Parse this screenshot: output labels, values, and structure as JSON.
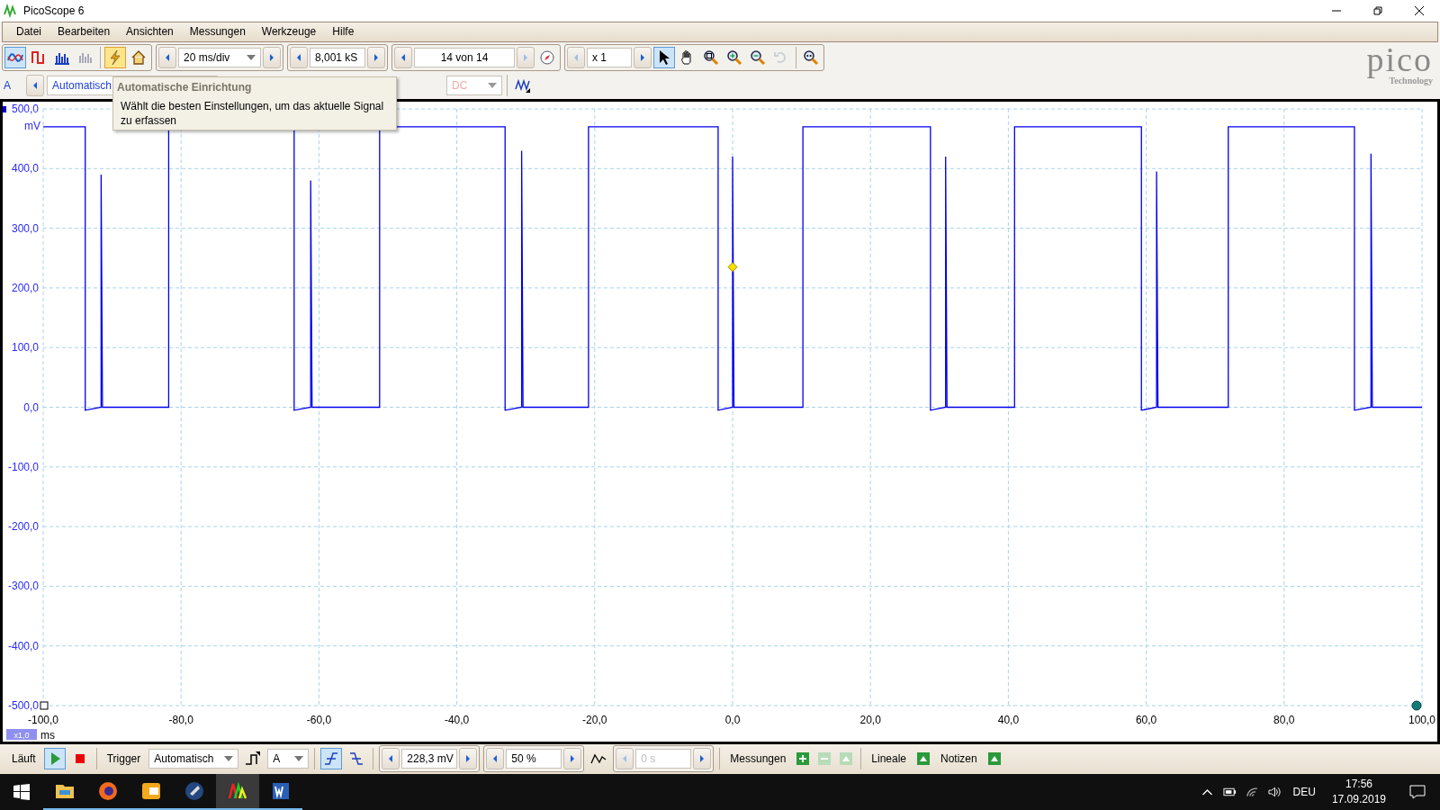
{
  "window": {
    "title": "PicoScope 6"
  },
  "menu": [
    "Datei",
    "Bearbeiten",
    "Ansichten",
    "Messungen",
    "Werkzeuge",
    "Hilfe"
  ],
  "view_modes": [
    {
      "kind": "scope",
      "selected": true
    },
    {
      "kind": "persistence",
      "selected": false
    },
    {
      "kind": "spectrum",
      "selected": false
    },
    {
      "kind": "spectrum-off",
      "selected": false
    }
  ],
  "auto_setup": {
    "selected": true
  },
  "timebase": "20 ms/div",
  "samples": "8,001 kS",
  "buffer": "14 von 14",
  "zoom_factor": "x 1",
  "tools": [
    {
      "kind": "pointer",
      "selected": true,
      "disabled": false
    },
    {
      "kind": "hand",
      "selected": false,
      "disabled": false
    },
    {
      "kind": "zoom-box",
      "selected": false,
      "disabled": false
    },
    {
      "kind": "zoom-in",
      "selected": false,
      "disabled": false
    },
    {
      "kind": "zoom-out",
      "selected": false,
      "disabled": false
    },
    {
      "kind": "undo",
      "selected": false,
      "disabled": true
    },
    {
      "kind": "zoom-100",
      "selected": false,
      "disabled": false
    }
  ],
  "logo": {
    "text": "pico",
    "subtext": "Technology"
  },
  "channel_bar": {
    "channel": "A",
    "range": "Automatisch",
    "coupling": "DC"
  },
  "tooltip": {
    "title": "Automatische Einrichtung",
    "body": "Wählt die besten Einstellungen, um das aktuelle Signal zu erfassen"
  },
  "plot": {
    "y_unit": "mV",
    "y_ticks": [
      "500,0",
      "400,0",
      "300,0",
      "200,0",
      "100,0",
      "0,0",
      "-100,0",
      "-200,0",
      "-300,0",
      "-400,0",
      "-500,0"
    ],
    "x_ticks": [
      "-100,0",
      "-80,0",
      "-60,0",
      "-40,0",
      "-20,0",
      "0,0",
      "20,0",
      "40,0",
      "60,0",
      "80,0",
      "100,0"
    ],
    "x_unit": "ms",
    "zoom_badge": "x1,0"
  },
  "bottom_bar": {
    "run_state": "Läuft",
    "running": true,
    "trigger_label": "Trigger",
    "trigger_mode": "Automatisch",
    "trigger_source": "A",
    "rising_edge": true,
    "threshold": "228,3 mV",
    "pre_trigger": "50 %",
    "delay": "0 s",
    "measurements_label": "Messungen",
    "rulers_label": "Lineale",
    "notes_label": "Notizen"
  },
  "taskbar": {
    "apps": [
      {
        "kind": "folder",
        "active": false
      },
      {
        "kind": "browser",
        "active": false
      },
      {
        "kind": "mail",
        "active": false
      },
      {
        "kind": "disc",
        "active": false
      },
      {
        "kind": "scope",
        "active": true
      },
      {
        "kind": "word",
        "active": false
      }
    ],
    "language": "DEU",
    "time": "17:56",
    "date": "17.09.2019"
  }
}
